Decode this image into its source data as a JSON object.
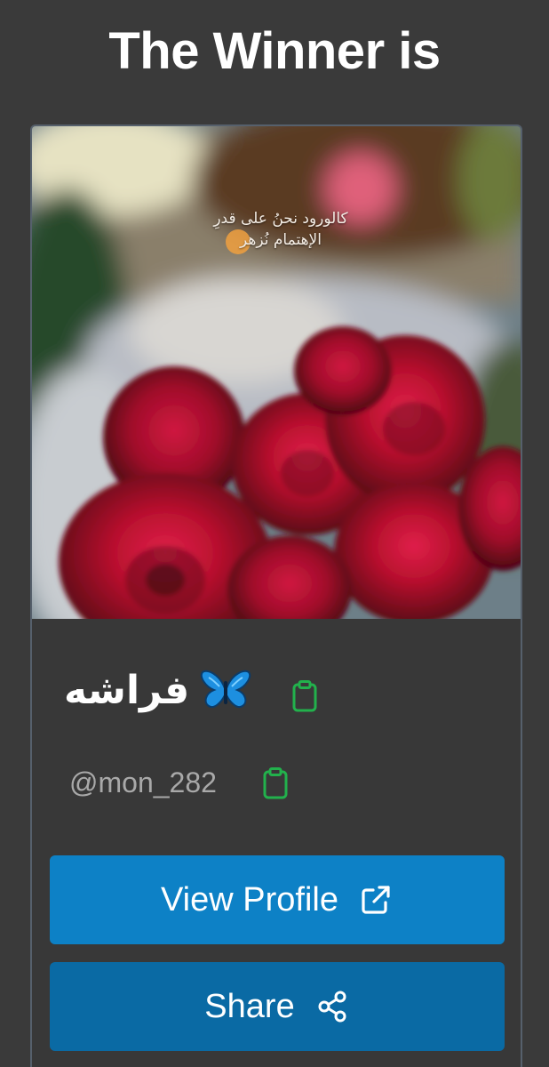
{
  "header": {
    "title": "The Winner is"
  },
  "winner": {
    "photo_caption_line1": "كالورود نحنُ على قدرِ",
    "photo_caption_line2": "الإهتمام نُزهر",
    "display_name": "فراشه",
    "username": "@mon_282"
  },
  "actions": {
    "view_profile_label": "View Profile",
    "share_label": "Share"
  },
  "icons": {
    "copy_name": "clipboard-icon",
    "copy_username": "clipboard-icon",
    "view_profile": "external-link-icon",
    "share": "share-icon",
    "emoji": "butterfly-icon"
  },
  "colors": {
    "background": "#3a3a3a",
    "card_border": "#56606c",
    "view_button": "#0d81c6",
    "share_button": "#0a6aa4",
    "clipboard_green": "#22b14c",
    "username_gray": "#a9a9a9"
  }
}
